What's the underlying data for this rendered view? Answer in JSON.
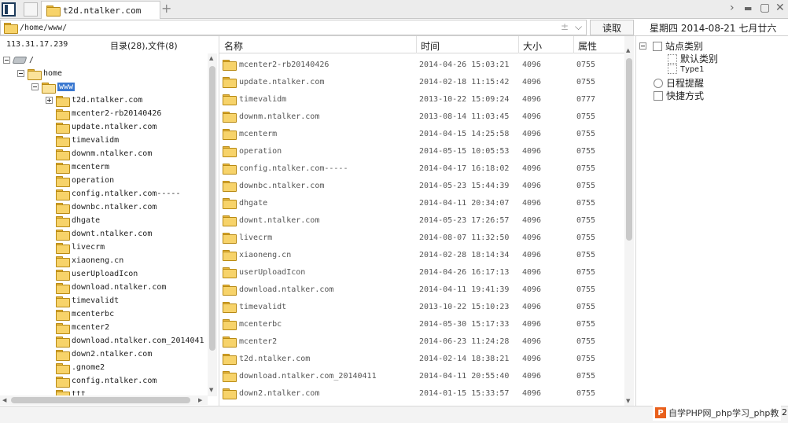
{
  "tab": {
    "title": "t2d.ntalker.com",
    "new_tab": "+"
  },
  "window_controls": {
    "next": "›",
    "minimize": "▬",
    "maximize": "▢",
    "close": "✕"
  },
  "address": {
    "path": "/home/www/",
    "bookmark": "±",
    "dropdown": "⌵",
    "read_button": "读取"
  },
  "datebar": "星期四 2014-08-21 七月廿六",
  "info": {
    "ip": "113.31.17.239",
    "counts": "目录(28),文件(8)"
  },
  "tree": {
    "root": "/",
    "home": "home",
    "www": "www",
    "items": [
      "t2d.ntalker.com",
      "mcenter2-rb20140426",
      "update.ntalker.com",
      "timevalidm",
      "downm.ntalker.com",
      "mcenterm",
      "operation",
      "config.ntalker.com-----",
      "downbc.ntalker.com",
      "dhgate",
      "downt.ntalker.com",
      "livecrm",
      "xiaoneng.cn",
      "userUploadIcon",
      "download.ntalker.com",
      "timevalidt",
      "mcenterbc",
      "mcenter2",
      "download.ntalker.com_2014041",
      "down2.ntalker.com",
      ".gnome2",
      "config.ntalker.com",
      "ttt"
    ]
  },
  "filelist": {
    "headers": {
      "name": "名称",
      "time": "时间",
      "size": "大小",
      "perm": "属性"
    },
    "rows": [
      {
        "name": "mcenter2-rb20140426",
        "time": "2014-04-26 15:03:21",
        "size": "4096",
        "perm": "0755"
      },
      {
        "name": "update.ntalker.com",
        "time": "2014-02-18 11:15:42",
        "size": "4096",
        "perm": "0755"
      },
      {
        "name": "timevalidm",
        "time": "2013-10-22 15:09:24",
        "size": "4096",
        "perm": "0777"
      },
      {
        "name": "downm.ntalker.com",
        "time": "2013-08-14 11:03:45",
        "size": "4096",
        "perm": "0755"
      },
      {
        "name": "mcenterm",
        "time": "2014-04-15 14:25:58",
        "size": "4096",
        "perm": "0755"
      },
      {
        "name": "operation",
        "time": "2014-05-15 10:05:53",
        "size": "4096",
        "perm": "0755"
      },
      {
        "name": "config.ntalker.com-----",
        "time": "2014-04-17 16:18:02",
        "size": "4096",
        "perm": "0755"
      },
      {
        "name": "downbc.ntalker.com",
        "time": "2014-05-23 15:44:39",
        "size": "4096",
        "perm": "0755"
      },
      {
        "name": "dhgate",
        "time": "2014-04-11 20:34:07",
        "size": "4096",
        "perm": "0755"
      },
      {
        "name": "downt.ntalker.com",
        "time": "2014-05-23 17:26:57",
        "size": "4096",
        "perm": "0755"
      },
      {
        "name": "livecrm",
        "time": "2014-08-07 11:32:50",
        "size": "4096",
        "perm": "0755"
      },
      {
        "name": "xiaoneng.cn",
        "time": "2014-02-28 18:14:34",
        "size": "4096",
        "perm": "0755"
      },
      {
        "name": "userUploadIcon",
        "time": "2014-04-26 16:17:13",
        "size": "4096",
        "perm": "0755"
      },
      {
        "name": "download.ntalker.com",
        "time": "2014-04-11 19:41:39",
        "size": "4096",
        "perm": "0755"
      },
      {
        "name": "timevalidt",
        "time": "2013-10-22 15:10:23",
        "size": "4096",
        "perm": "0755"
      },
      {
        "name": "mcenterbc",
        "time": "2014-05-30 15:17:33",
        "size": "4096",
        "perm": "0755"
      },
      {
        "name": "mcenter2",
        "time": "2014-06-23 11:24:28",
        "size": "4096",
        "perm": "0755"
      },
      {
        "name": "t2d.ntalker.com",
        "time": "2014-02-14 18:38:21",
        "size": "4096",
        "perm": "0755"
      },
      {
        "name": "download.ntalker.com_20140411",
        "time": "2014-04-11 20:55:40",
        "size": "4096",
        "perm": "0755"
      },
      {
        "name": "down2.ntalker.com",
        "time": "2014-01-15 15:33:57",
        "size": "4096",
        "perm": "0755"
      }
    ]
  },
  "rightpanel": {
    "site_category": "站点类别",
    "default_category": "默认类别",
    "type1": "Type1",
    "schedule": "日程提醒",
    "shortcuts": "快捷方式"
  },
  "watermark": {
    "logo": "P",
    "text": "自学PHP网_php学习_php教"
  },
  "bottom_right_char": "2"
}
